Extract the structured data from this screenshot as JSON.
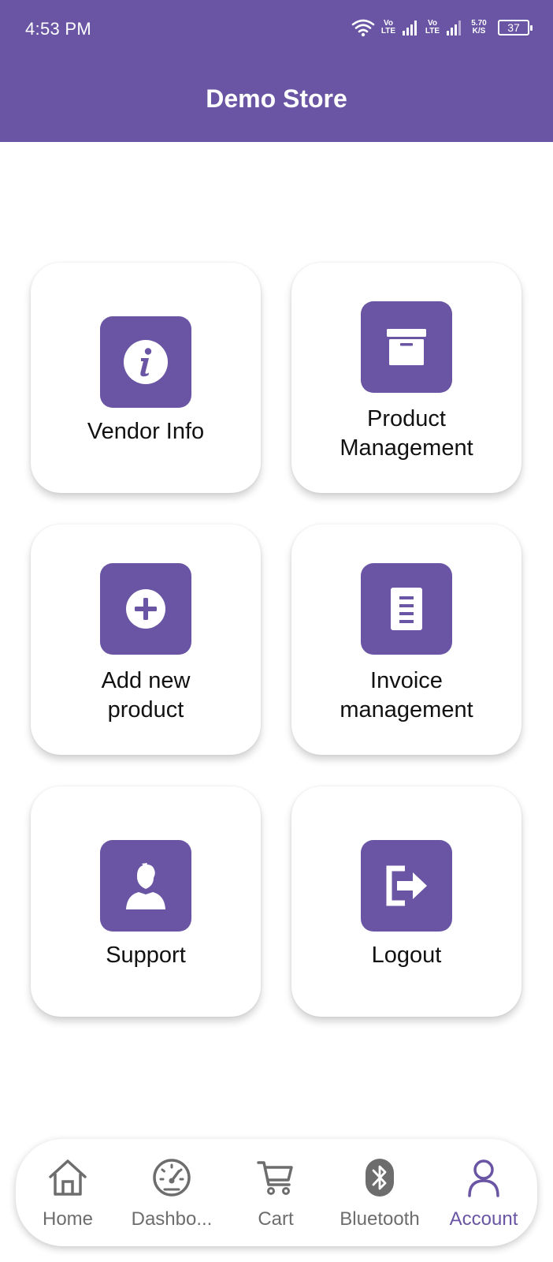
{
  "status_bar": {
    "time": "4:53 PM",
    "network_1": "Vo LTE",
    "network_2": "Vo LTE",
    "speed_value": "5.70",
    "speed_unit": "K/S",
    "battery": "37"
  },
  "header": {
    "title": "Demo Store"
  },
  "menu": {
    "vendor_info": {
      "label": "Vendor Info",
      "icon": "info-icon"
    },
    "product_management": {
      "label_1": "Product",
      "label_2": "Management",
      "icon": "archive-box-icon"
    },
    "add_new_product": {
      "label_1": "Add new",
      "label_2": "product",
      "icon": "plus-circle-icon"
    },
    "invoice_management": {
      "label_1": "Invoice",
      "label_2": "management",
      "icon": "document-icon"
    },
    "support": {
      "label": "Support",
      "icon": "person-icon"
    },
    "logout": {
      "label": "Logout",
      "icon": "logout-icon"
    }
  },
  "bottom_nav": {
    "home": {
      "label": "Home",
      "icon": "home-icon"
    },
    "dashboard": {
      "label": "Dashbo...",
      "icon": "speedometer-icon"
    },
    "cart": {
      "label": "Cart",
      "icon": "cart-icon"
    },
    "bluetooth": {
      "label": "Bluetooth",
      "icon": "bluetooth-icon"
    },
    "account": {
      "label": "Account",
      "icon": "account-icon",
      "active": true
    }
  },
  "colors": {
    "primary": "#6955a4",
    "nav_inactive": "#6d6d6d",
    "background": "#ffffff"
  }
}
